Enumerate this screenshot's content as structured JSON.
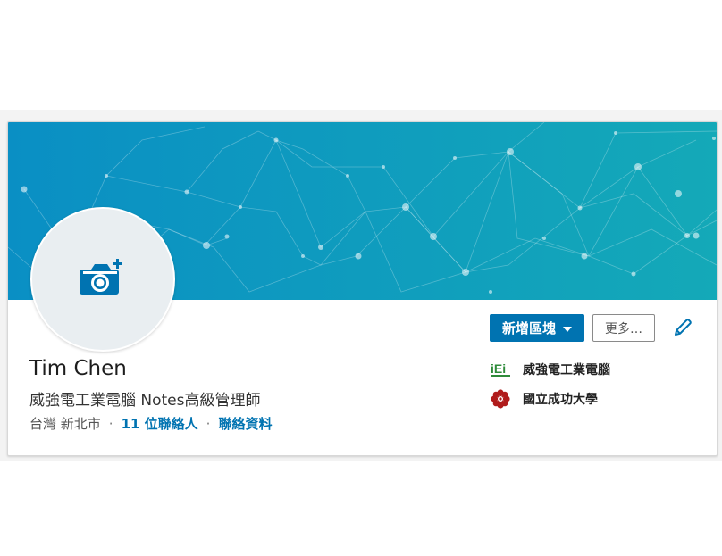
{
  "profile": {
    "name": "Tim Chen",
    "headline": "威強電工業電腦 Notes高級管理師",
    "location": "台灣 新北市",
    "connections": "11 位聯絡人",
    "contact_info": "聯絡資料",
    "separator": "·"
  },
  "actions": {
    "add_section": "新增區塊",
    "more": "更多…"
  },
  "organizations": [
    {
      "name": "威強電工業電腦",
      "logo_text": "iEi",
      "logo_icon": "iei-logo-icon"
    },
    {
      "name": "國立成功大學",
      "logo_icon": "ncku-seal-icon"
    }
  ],
  "colors": {
    "accent": "#0073b1",
    "banner_start": "#0a8fc4",
    "banner_end": "#14a9b8",
    "camera_icon": "#0073b1"
  },
  "icons": {
    "avatar": "camera-plus-icon",
    "edit": "pencil-icon",
    "dropdown": "caret-down-icon"
  }
}
